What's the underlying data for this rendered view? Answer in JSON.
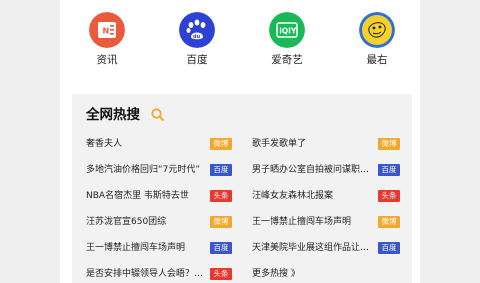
{
  "apps": [
    {
      "label": "资讯",
      "icon": "news-app-icon"
    },
    {
      "label": "百度",
      "icon": "baidu-paw-icon"
    },
    {
      "label": "爱奇艺",
      "icon": "iqiyi-icon"
    },
    {
      "label": "最右",
      "icon": "zuiyou-icon"
    }
  ],
  "hot": {
    "title": "全网热搜",
    "left": [
      {
        "text": "奢香夫人",
        "badge": "微博",
        "color": "#f2a82a"
      },
      {
        "text": "多地汽油价格回归“7元时代”",
        "badge": "百度",
        "color": "#3a57c9"
      },
      {
        "text": "NBA名宿杰里 韦斯特去世",
        "badge": "头条",
        "color": "#e8392f"
      },
      {
        "text": "汪苏泷官宣650团综",
        "badge": "微博",
        "color": "#f2a82a"
      },
      {
        "text": "王一博禁止擅闯车场声明",
        "badge": "百度",
        "color": "#3a57c9"
      },
      {
        "text": "是否安排中辍领导人会晤？…",
        "badge": "头条",
        "color": "#e8392f"
      }
    ],
    "right": [
      {
        "text": "歌手发歌单了",
        "badge": "微博",
        "color": "#f2a82a"
      },
      {
        "text": "男子晒办公室自拍被问谋职打上",
        "badge": "百度",
        "color": "#3a57c9"
      },
      {
        "text": "汪峰女友森林北报案",
        "badge": "头条",
        "color": "#e8392f"
      },
      {
        "text": "王一博禁止擅闯车场声明",
        "badge": "微博",
        "color": "#f2a82a"
      },
      {
        "text": "天津美院毕业展这组作品让…",
        "badge": "百度",
        "color": "#3a57c9"
      }
    ],
    "more": "更多热搜 》"
  }
}
